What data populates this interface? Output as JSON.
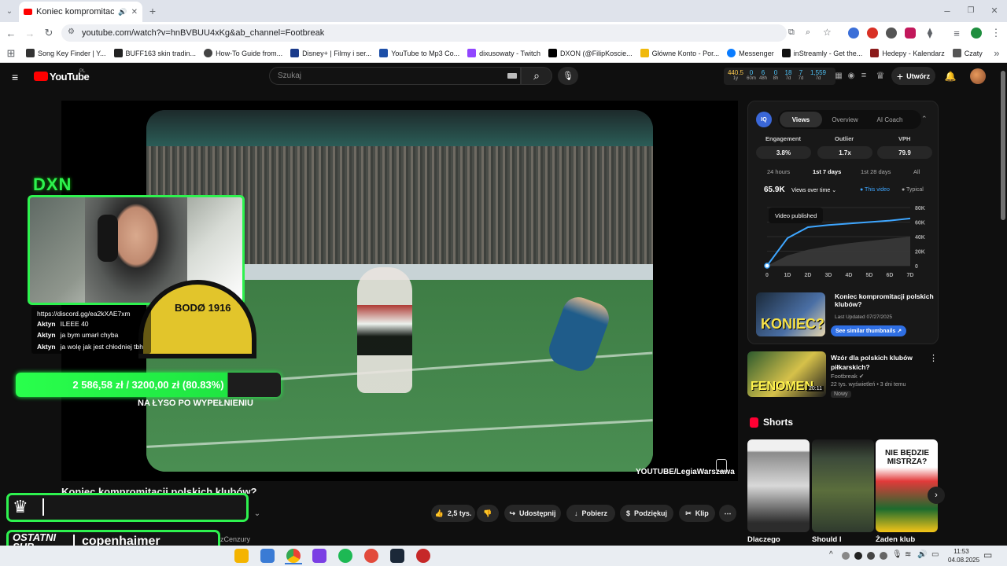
{
  "browser": {
    "tab_title": "Koniec kompromitacji polsk",
    "url": "youtube.com/watch?v=hnBVBUU4xKg&ab_channel=Footbreak",
    "bookmarks": [
      "Song Key Finder | Y...",
      "BUFF163 skin tradin...",
      "How-To Guide from...",
      "Disney+ | Filmy i ser...",
      "YouTube to Mp3 Co...",
      "dixusowaty - Twitch",
      "DXON (@FilipKoscie...",
      "Główne Konto - Por...",
      "Messenger",
      "inStreamly - Get the...",
      "Hedepy - Kalendarz",
      "Czaty"
    ]
  },
  "youtube": {
    "logo": "YouTube",
    "country": "PL",
    "search_placeholder": "Szukaj",
    "create_label": "Utwórz",
    "stats_strip": [
      {
        "value": "440.5",
        "label": "1y"
      },
      {
        "value": "0",
        "label": "60m"
      },
      {
        "value": "6",
        "label": "48h"
      },
      {
        "value": "0",
        "label": "8h"
      },
      {
        "value": "18",
        "label": "7d"
      },
      {
        "value": "7",
        "label": "7d"
      },
      {
        "value": "1,559",
        "label": "7d"
      }
    ]
  },
  "video": {
    "watermark": "YOUTUBE/LegiaWarszawa",
    "title_partial": "Koniec kompromitacji polskich klubów?",
    "channel_partial": "rezCenzury",
    "actions": {
      "like": "2,5 tys.",
      "share": "Udostępnij",
      "download": "Pobierz",
      "thanks": "Podziękuj",
      "clip": "Klip"
    }
  },
  "stream_overlay": {
    "logo": "DXN",
    "chat": [
      {
        "user": "",
        "text": "https://discord.gg/ea2kXAE7xm"
      },
      {
        "user": "Aktyn",
        "text": "ILEEE 40"
      },
      {
        "user": "Aktyn",
        "text": "ja bym umarł chyba"
      },
      {
        "user": "Aktyn",
        "text": "ja wolę jak jest chłodniej tbh"
      }
    ],
    "goal_text": "2 586,58 zł / 3200,00 zł (80.83%)",
    "goal_progress": 0.8083,
    "goal_caption": "NA ŁYSO PO WYPEŁNIENIU",
    "last_sub_label": "OSTATNI SUB",
    "last_sub_name": "copenhaimer"
  },
  "analytics": {
    "tabs": [
      "Views",
      "Overview",
      "AI Coach"
    ],
    "kpis": [
      {
        "label": "Engagement",
        "value": "3.8%"
      },
      {
        "label": "Outlier",
        "value": "1.7x"
      },
      {
        "label": "VPH",
        "value": "79.9"
      }
    ],
    "periods": [
      "24 hours",
      "1st 7 days",
      "1st 28 days",
      "All"
    ],
    "total_views": "65.9K",
    "metric_select": "Views over time",
    "legend_this": "This video",
    "legend_typical": "Typical",
    "tooltip": "Video published",
    "thumb_title": "Koniec kompromitacji polskich klubów?",
    "thumb_updated": "Last Updated 07/27/2025",
    "thumb_button": "See similar thumbnails ↗",
    "thumb_overlay_text": "KONIEC?"
  },
  "chart_data": {
    "type": "area",
    "x": [
      0,
      1,
      2,
      3,
      4,
      5,
      6,
      7
    ],
    "xlabels": [
      "0",
      "1D",
      "2D",
      "3D",
      "4D",
      "5D",
      "6D",
      "7D"
    ],
    "ylabels": [
      "80K",
      "60K",
      "40K",
      "20K",
      "0"
    ],
    "ylim": [
      0,
      80000
    ],
    "series": [
      {
        "name": "This video",
        "values": [
          0,
          38000,
          53000,
          56000,
          58000,
          60000,
          62000,
          65000
        ]
      },
      {
        "name": "Typical",
        "values": [
          0,
          14000,
          22000,
          27000,
          31000,
          34000,
          37000,
          40000
        ]
      }
    ]
  },
  "recommendation": {
    "title": "Wzór dla polskich klubów piłkarskich?",
    "channel": "Footbreak",
    "meta": "22 tys. wyświetleń • 3 dni temu",
    "badge": "Nowy",
    "duration": "20:11",
    "thumb_text": "FENOMEN"
  },
  "shorts": {
    "heading": "Shorts",
    "items": [
      {
        "title": "Dlaczego",
        "overlay": ""
      },
      {
        "title": "Should I",
        "overlay": ""
      },
      {
        "title": "Żaden klub",
        "overlay": "NIE BĘDZIE MISTRZA?"
      }
    ]
  },
  "taskbar": {
    "time": "11:53",
    "date": "04.08.2025"
  },
  "colors": {
    "accent_green": "#2ef24f",
    "yt_red": "#ff0000",
    "chart_blue": "#3ea6ff"
  }
}
